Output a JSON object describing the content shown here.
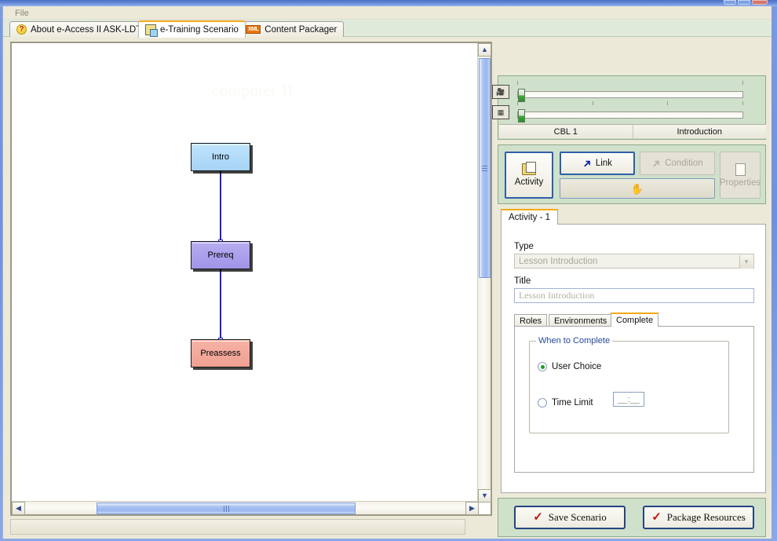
{
  "window": {
    "controls": [
      "minimize",
      "maximize",
      "close"
    ]
  },
  "menubar": {
    "items": [
      "File"
    ],
    "file_label": "File"
  },
  "tabs": [
    {
      "label": "About e-Access II ASK-LDT",
      "icon": "help-icon",
      "active": false
    },
    {
      "label": "e-Training Scenario",
      "icon": "scenario-icon",
      "active": true
    },
    {
      "label": "Content Packager",
      "icon": "xml-icon",
      "active": false
    }
  ],
  "canvas": {
    "watermark": "computer II",
    "nodes": [
      {
        "id": "intro",
        "label": "Intro",
        "color": "#a6d3f5"
      },
      {
        "id": "prereq",
        "label": "Prereq",
        "color": "#a094e8"
      },
      {
        "id": "preassess",
        "label": "Preassess",
        "color": "#f0a091"
      }
    ],
    "edges": [
      {
        "from": "intro",
        "to": "prereq",
        "color": "#1f1fd0"
      },
      {
        "from": "prereq",
        "to": "preassess",
        "color": "#1f1fd0"
      }
    ],
    "scrollbars": {
      "vertical": {
        "up": "▲",
        "down": "▼"
      },
      "horizontal": {
        "left": "◀",
        "right": "▶"
      }
    }
  },
  "preview": {
    "sliders": [
      {
        "icon": "camera-icon",
        "value": 0,
        "ticks": 2
      },
      {
        "icon": "filmstrip-icon",
        "value": 0,
        "ticks": 4
      }
    ],
    "status": [
      "CBL 1",
      "Introduction"
    ]
  },
  "toolbar": {
    "activity_label": "Activity",
    "link_label": "Link",
    "condition_label": "Condition",
    "properties_label": "Properties",
    "hand_label": ""
  },
  "form": {
    "tab_label": "Activity - 1",
    "type_label": "Type",
    "type_value": "Lesson Introduction",
    "title_label": "Title",
    "title_value": "Lesson Introduction",
    "inner_tabs": [
      {
        "label": "Roles",
        "active": false
      },
      {
        "label": "Environments",
        "active": false
      },
      {
        "label": "Complete",
        "active": true
      }
    ],
    "complete": {
      "group_legend": "When to Complete",
      "user_choice_label": "User Choice",
      "user_choice_selected": true,
      "time_limit_label": "Time Limit",
      "time_limit_selected": false,
      "time_value": "__:__"
    }
  },
  "actions": {
    "save_label": "Save Scenario",
    "package_label": "Package Resources"
  },
  "colors": {
    "accent_orange": "#f5a81c",
    "panel_green": "#cfe0cb",
    "button_blue": "#24457f",
    "edge_blue": "#1f1fd0"
  }
}
